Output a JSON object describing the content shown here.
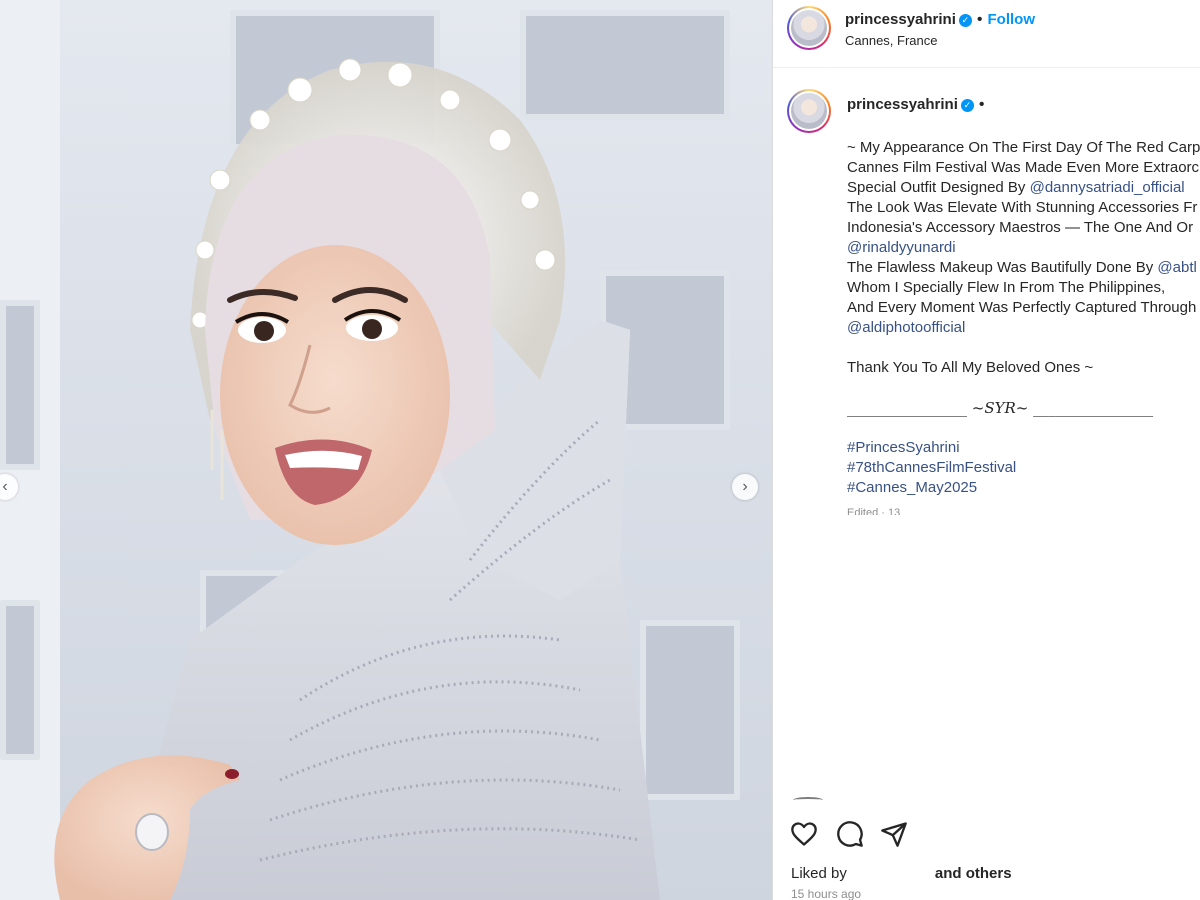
{
  "post": {
    "username": "princessyahrini",
    "location": "Cannes, France",
    "follow_label": "Follow",
    "header_separator": "•",
    "caption_separator": "•"
  },
  "caption": {
    "lines": [
      "~ My Appearance On The First Day Of The Red Carp",
      "Cannes Film Festival Was Made Even More Extraorc",
      "Special Outfit Designed By ",
      "The Look Was Elevate With Stunning Accessories Fr",
      "Indonesia's Accessory Maestros — The One And Or",
      "",
      "The Flawless Makeup Was Bautifully Done By ",
      "Whom I Specially Flew In From The Philippines,",
      "And Every Moment Was Perfectly Captured Through",
      ""
    ],
    "mention_designer": "@dannysatriadi_official",
    "mention_accessory": "@rinaldyyunardi",
    "mention_makeup": "@abtl",
    "mention_photo": "@aldiphotoofficial",
    "thanks": "Thank You To All My Beloved Ones ~",
    "signature": "________________ ~SYR~ ________________",
    "hashtags": [
      "#PrincesSyahrini",
      "#78thCannesFilmFestival",
      "#Cannes_May2025"
    ],
    "edited": "Edited · 13"
  },
  "footer": {
    "liked_by": "Liked by",
    "and_others": "and others",
    "timestamp": "15 hours ago"
  },
  "icons": {
    "like": "heart-icon",
    "comment": "comment-icon",
    "share": "send-icon",
    "prev": "chevron-left-icon",
    "next": "chevron-right-icon",
    "verified": "verified-badge-icon"
  },
  "colors": {
    "link": "#385185",
    "follow": "#0095f6",
    "verified": "#0095f6",
    "muted": "#8e8e8e"
  }
}
